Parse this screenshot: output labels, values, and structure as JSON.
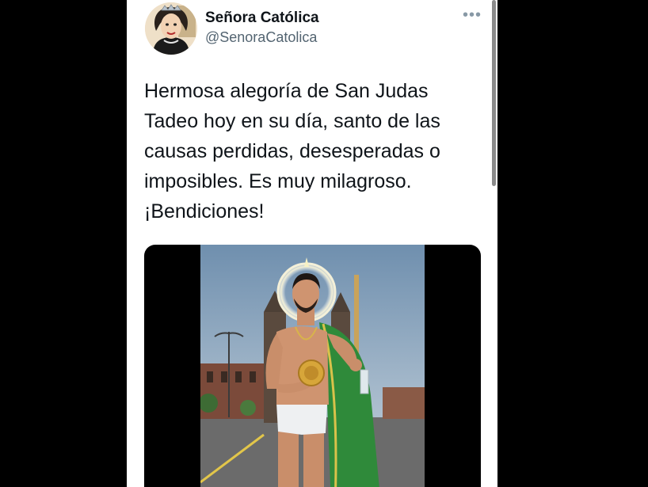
{
  "author": {
    "name": "Señora Católica",
    "handle": "@SenoraCatolica"
  },
  "tweet": {
    "text_lines": [
      "Hermosa alegoría de San Judas",
      "Tadeo hoy en su día, santo de las",
      "causas perdidas, desesperadas o",
      "imposibles. Es muy milagroso.",
      "¡Bendiciones!"
    ]
  },
  "icons": {
    "more": "more-horizontal-icon"
  },
  "colors": {
    "name": "#0f1419",
    "handle": "#536471",
    "robe": "#2f8a3a",
    "halo": "#f4f0d8",
    "background": "#000000"
  }
}
